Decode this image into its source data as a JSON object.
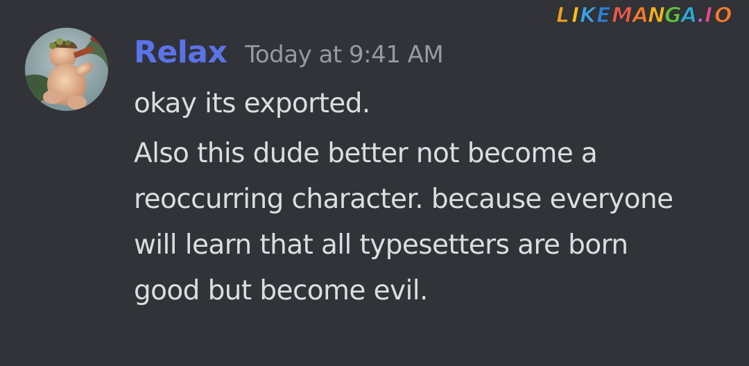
{
  "watermark": {
    "text": "LikeManga.io"
  },
  "message": {
    "username": "Relax",
    "timestamp": "Today at 9:41 AM",
    "lines": [
      "okay its exported.",
      "Also this dude better not become a",
      "reoccurring character. because everyone",
      "will learn that all typesetters are born",
      "good but become evil."
    ]
  },
  "colors": {
    "background": "#313338",
    "username": "#5b73e8",
    "timestamp": "#949ba4",
    "text": "#dbdee1"
  }
}
